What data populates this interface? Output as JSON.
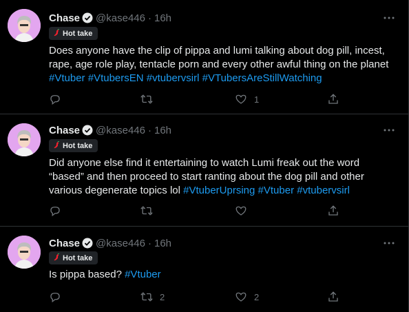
{
  "icons": {
    "verified": "verified-badge-icon",
    "more": "more-icon",
    "reply": "reply-icon",
    "retweet": "retweet-icon",
    "like": "like-icon",
    "share": "share-icon",
    "pepper": "hot-pepper-icon"
  },
  "colors": {
    "background": "#000000",
    "text": "#e7e9ea",
    "muted": "#71767b",
    "link": "#1d9bf0",
    "avatar_bg": "#e3a6ef"
  },
  "tweets": [
    {
      "author": "Chase",
      "handle": "@kase446",
      "time": "16h",
      "badge": "Hot take",
      "text_plain": "Does anyone have the clip of pippa and lumi talking about dog pill, incest, rape, age role play, tentacle porn and every other awful thing on the planet",
      "hashtags": [
        "#Vtuber",
        "#VtubersEN",
        "#vtubervsirl",
        "#VTubersAreStillWatching"
      ],
      "replies": "",
      "retweets": "",
      "likes": "1"
    },
    {
      "author": "Chase",
      "handle": "@kase446",
      "time": "16h",
      "badge": "Hot take",
      "text_plain": "Did anyone else find it entertaining to watch Lumi freak out the word “based” and then proceed to start ranting about the dog pill and other various degenerate topics lol",
      "hashtags": [
        "#VtuberUprsing",
        "#Vtuber",
        "#vtubervsirl"
      ],
      "replies": "",
      "retweets": "",
      "likes": ""
    },
    {
      "author": "Chase",
      "handle": "@kase446",
      "time": "16h",
      "badge": "Hot take",
      "text_plain": "Is pippa based?",
      "hashtags": [
        "#Vtuber"
      ],
      "replies": "",
      "retweets": "2",
      "likes": "2"
    }
  ]
}
